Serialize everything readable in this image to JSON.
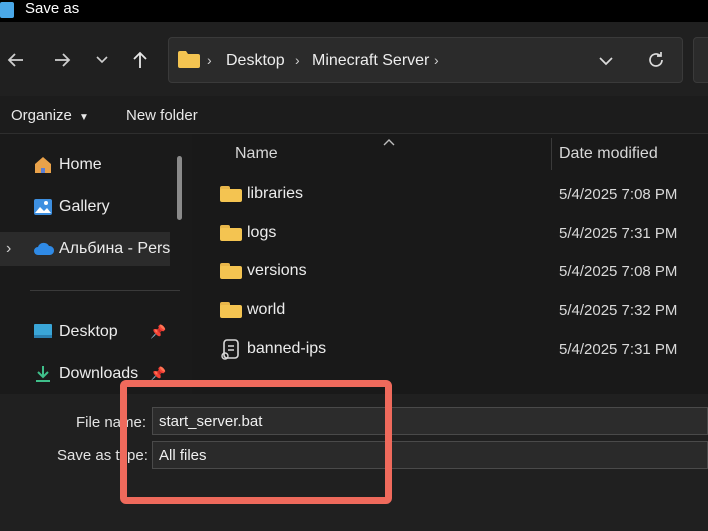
{
  "window": {
    "title": "Save as"
  },
  "nav": {
    "breadcrumb": [
      "Desktop",
      "Minecraft Server"
    ]
  },
  "toolbar": {
    "organize_label": "Organize",
    "new_folder_label": "New folder"
  },
  "sidebar": {
    "items": [
      {
        "label": "Home",
        "icon": "home-icon"
      },
      {
        "label": "Gallery",
        "icon": "gallery-icon"
      },
      {
        "label": "Альбина - Perso",
        "icon": "onedrive-cloud-icon"
      },
      {
        "label": "Desktop",
        "icon": "desktop-icon"
      },
      {
        "label": "Downloads",
        "icon": "downloads-icon"
      }
    ]
  },
  "file_list": {
    "columns": [
      "Name",
      "Date modified"
    ],
    "rows": [
      {
        "name": "libraries",
        "date": "5/4/2025 7:08 PM",
        "icon": "folder-icon"
      },
      {
        "name": "logs",
        "date": "5/4/2025 7:31 PM",
        "icon": "folder-icon"
      },
      {
        "name": "versions",
        "date": "5/4/2025 7:08 PM",
        "icon": "folder-icon"
      },
      {
        "name": "world",
        "date": "5/4/2025 7:32 PM",
        "icon": "folder-icon"
      },
      {
        "name": "banned-ips",
        "date": "5/4/2025 7:31 PM",
        "icon": "script-file-icon"
      }
    ]
  },
  "save_form": {
    "file_name_label": "File name:",
    "file_name_value": "start_server.bat",
    "save_type_label": "Save as type:",
    "save_type_value": "All files"
  },
  "colors": {
    "highlight": "#ef6a5c",
    "folder": "#f4c451",
    "background": "#202020"
  }
}
